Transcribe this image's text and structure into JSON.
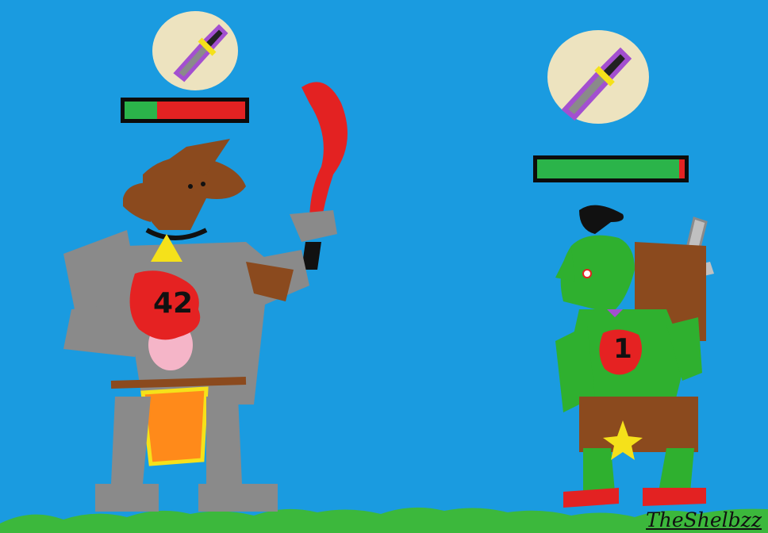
{
  "player": {
    "name": "kobold-warrior",
    "hit_splat": "42",
    "hp_fraction": 0.27,
    "combat_style": "dagger-icon",
    "color_skin": "#8b4a1e",
    "color_armor": "#8a8a8a",
    "weapon": "red-scimitar"
  },
  "enemy": {
    "name": "goblin-warrior",
    "hit_splat": "1",
    "hp_fraction": 0.96,
    "combat_style": "dagger-icon",
    "color_skin": "#2fb02f",
    "weapon": "silver-sword"
  },
  "colors": {
    "sky": "#1a9be0",
    "grass": "#3cb83c",
    "hp_green": "#2bb44a",
    "hp_red": "#e32222",
    "splat_red": "#e52222",
    "badge": "#ede3bf"
  },
  "signature": "TheShelbzz"
}
